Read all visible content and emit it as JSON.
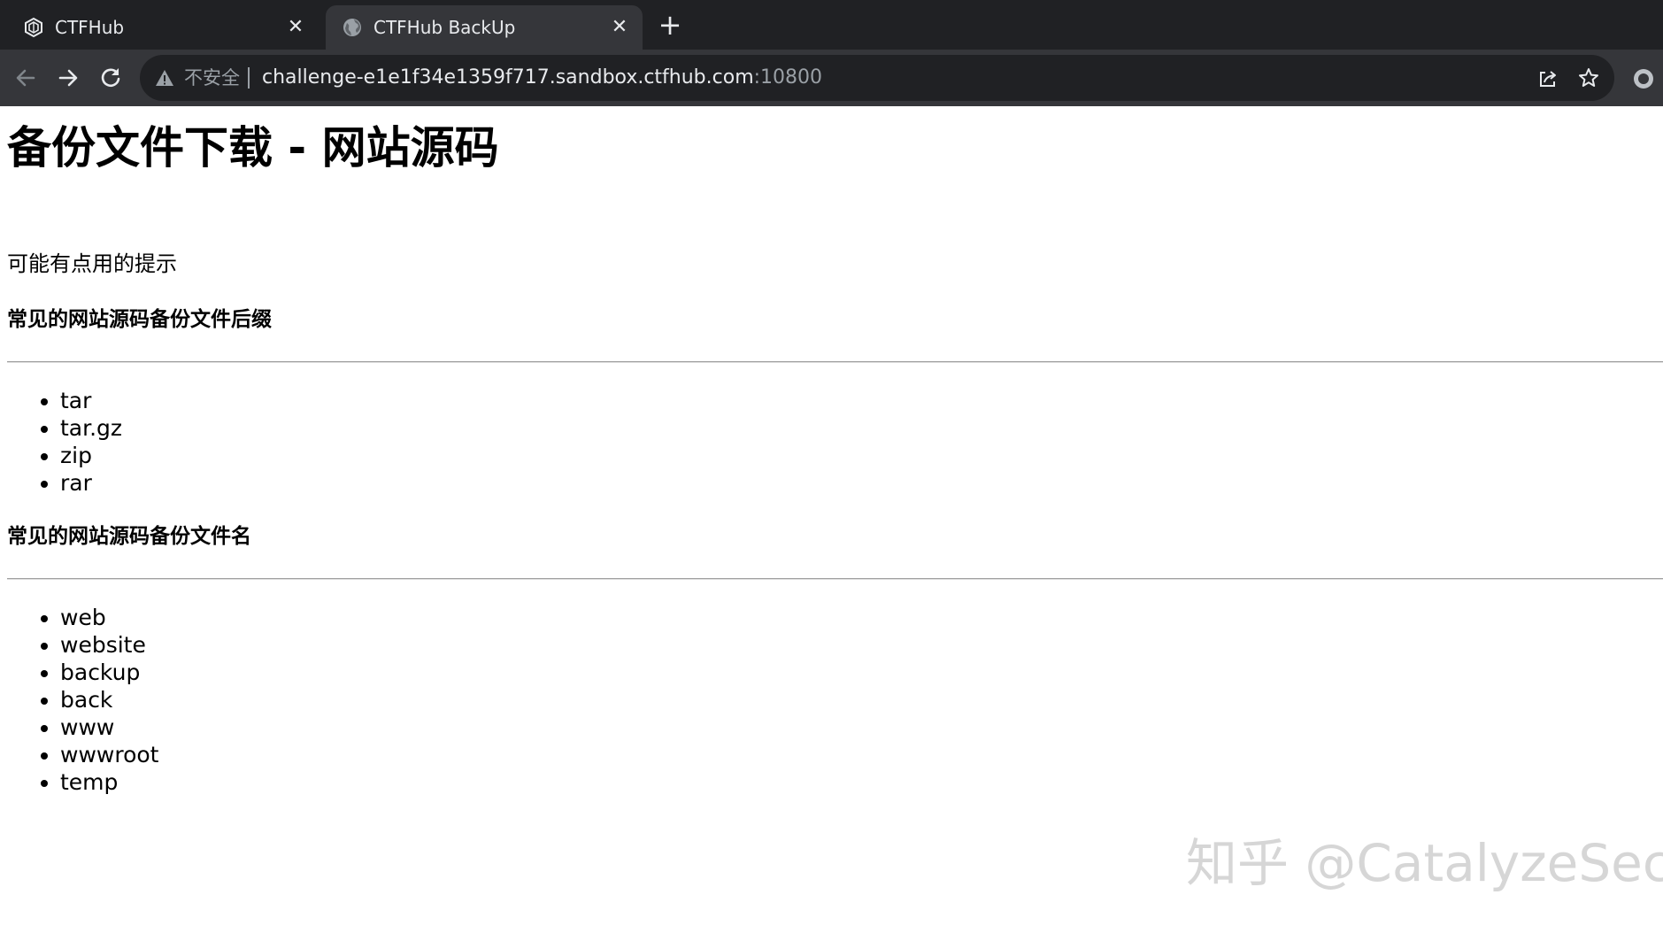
{
  "browser": {
    "tabs": [
      {
        "title": "CTFHub",
        "icon": "ctfhub-logo-icon",
        "active": false
      },
      {
        "title": "CTFHub BackUp",
        "icon": "globe-icon",
        "active": true
      }
    ],
    "new_tab_label": "+",
    "close_label": "✕",
    "security_label": "不安全",
    "url_host": "challenge-e1e1f34e1359f717.sandbox.ctfhub.com",
    "url_port": ":10800",
    "colors": {
      "tabstrip": "#202124",
      "toolbar": "#35363a",
      "omnibox": "#202124",
      "text": "#e8eaed",
      "muted": "#9aa0a6"
    }
  },
  "page": {
    "title": "备份文件下载 - 网站源码",
    "hint": "可能有点用的提示",
    "sections": [
      {
        "heading": "常见的网站源码备份文件后缀",
        "items": [
          "tar",
          "tar.gz",
          "zip",
          "rar"
        ]
      },
      {
        "heading": "常见的网站源码备份文件名",
        "items": [
          "web",
          "website",
          "backup",
          "back",
          "www",
          "wwwroot",
          "temp"
        ]
      }
    ],
    "watermark": "知乎 @CatalyzeSec"
  }
}
